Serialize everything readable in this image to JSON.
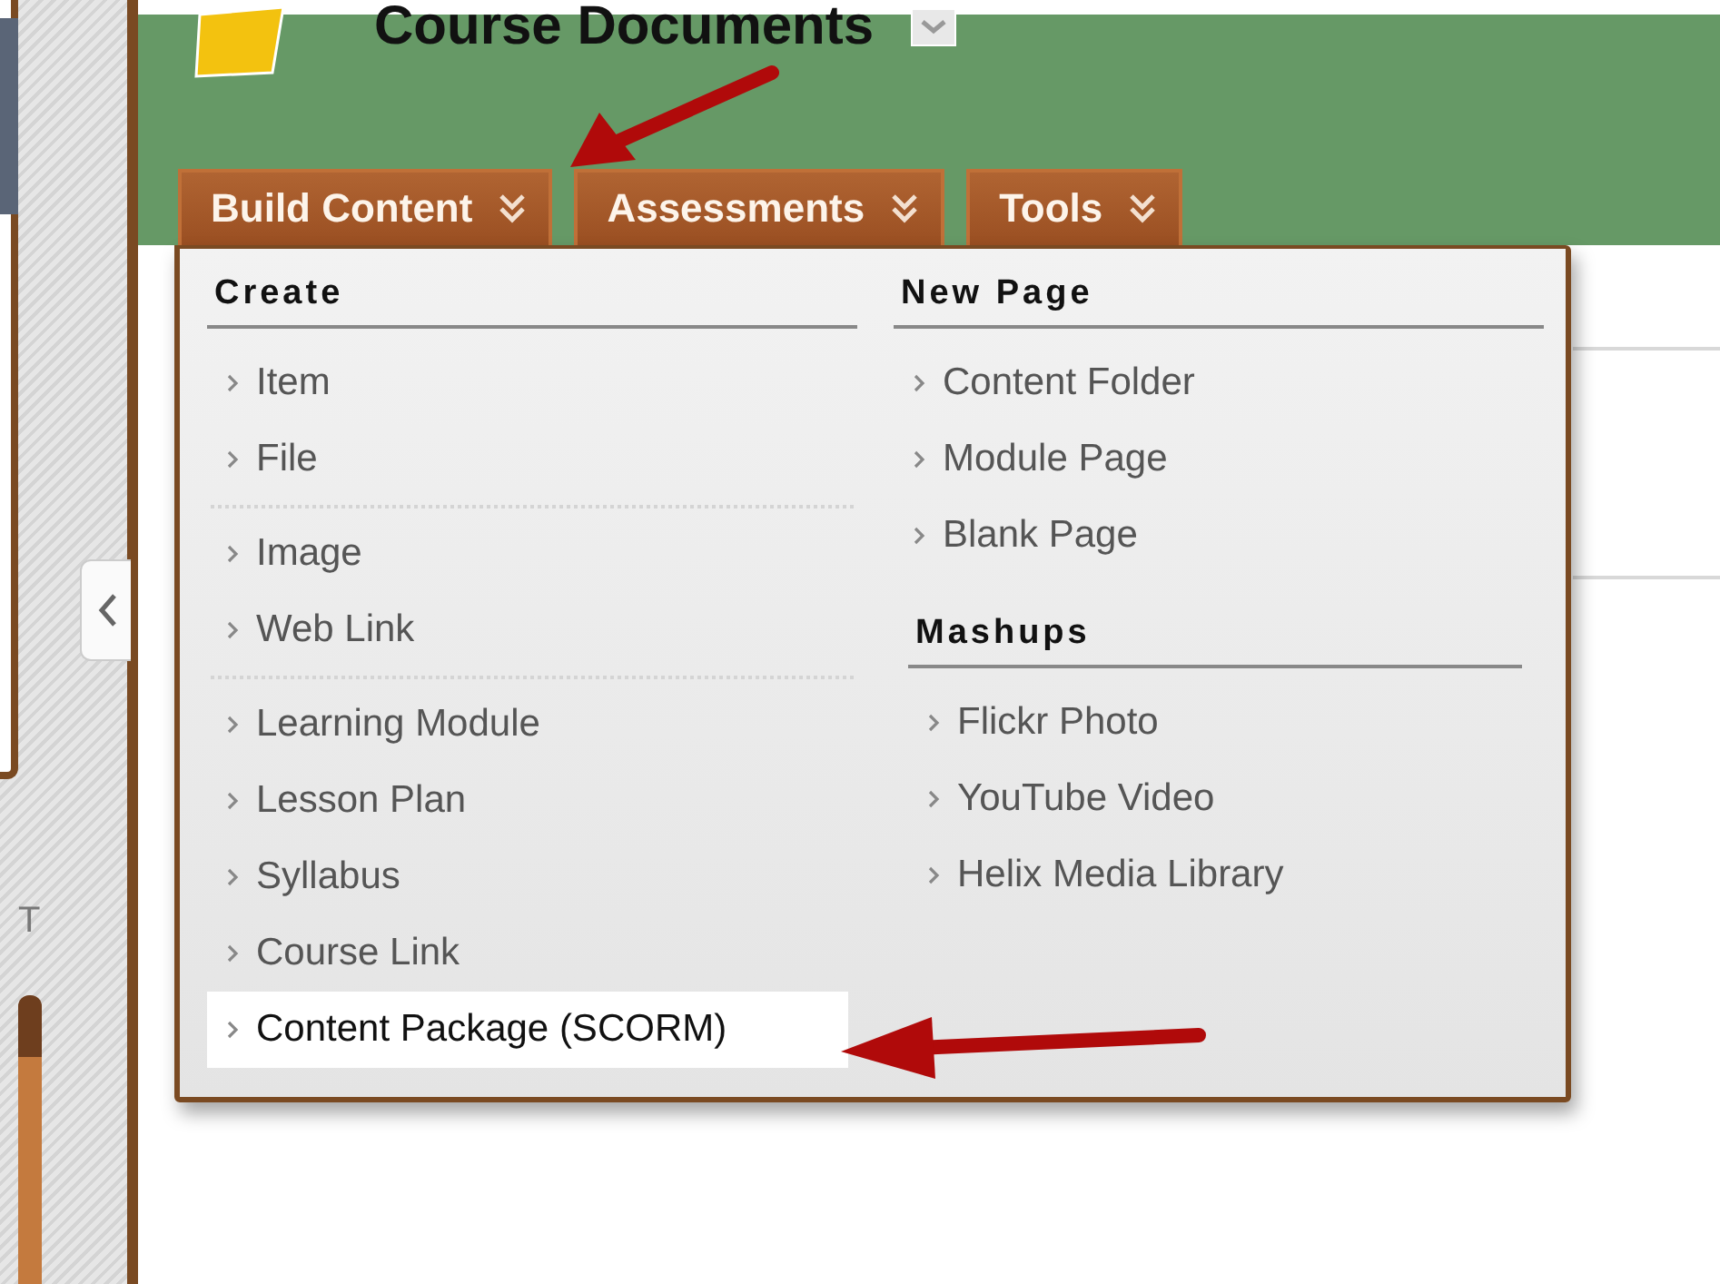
{
  "header": {
    "title": "Course Documents"
  },
  "sidebar": {
    "label": "T"
  },
  "tabs": [
    {
      "label": "Build Content"
    },
    {
      "label": "Assessments"
    },
    {
      "label": "Tools"
    }
  ],
  "menu": {
    "columns": [
      {
        "sections": [
          {
            "heading": "Create",
            "groups": [
              [
                {
                  "label": "Item",
                  "highlighted": false
                },
                {
                  "label": "File",
                  "highlighted": false
                }
              ],
              [
                {
                  "label": "Image",
                  "highlighted": false
                },
                {
                  "label": "Web Link",
                  "highlighted": false
                }
              ],
              [
                {
                  "label": "Learning Module",
                  "highlighted": false
                },
                {
                  "label": "Lesson Plan",
                  "highlighted": false
                },
                {
                  "label": "Syllabus",
                  "highlighted": false
                },
                {
                  "label": "Course Link",
                  "highlighted": false
                },
                {
                  "label": "Content Package (SCORM)",
                  "highlighted": true
                }
              ]
            ]
          }
        ]
      },
      {
        "sections": [
          {
            "heading": "New Page",
            "groups": [
              [
                {
                  "label": "Content Folder",
                  "highlighted": false
                },
                {
                  "label": "Module Page",
                  "highlighted": false
                },
                {
                  "label": "Blank Page",
                  "highlighted": false
                }
              ]
            ]
          },
          {
            "heading": "Mashups",
            "groups": [
              [
                {
                  "label": "Flickr Photo",
                  "highlighted": false
                },
                {
                  "label": "YouTube Video",
                  "highlighted": false
                },
                {
                  "label": "Helix Media Library",
                  "highlighted": false
                }
              ]
            ]
          }
        ]
      }
    ]
  }
}
